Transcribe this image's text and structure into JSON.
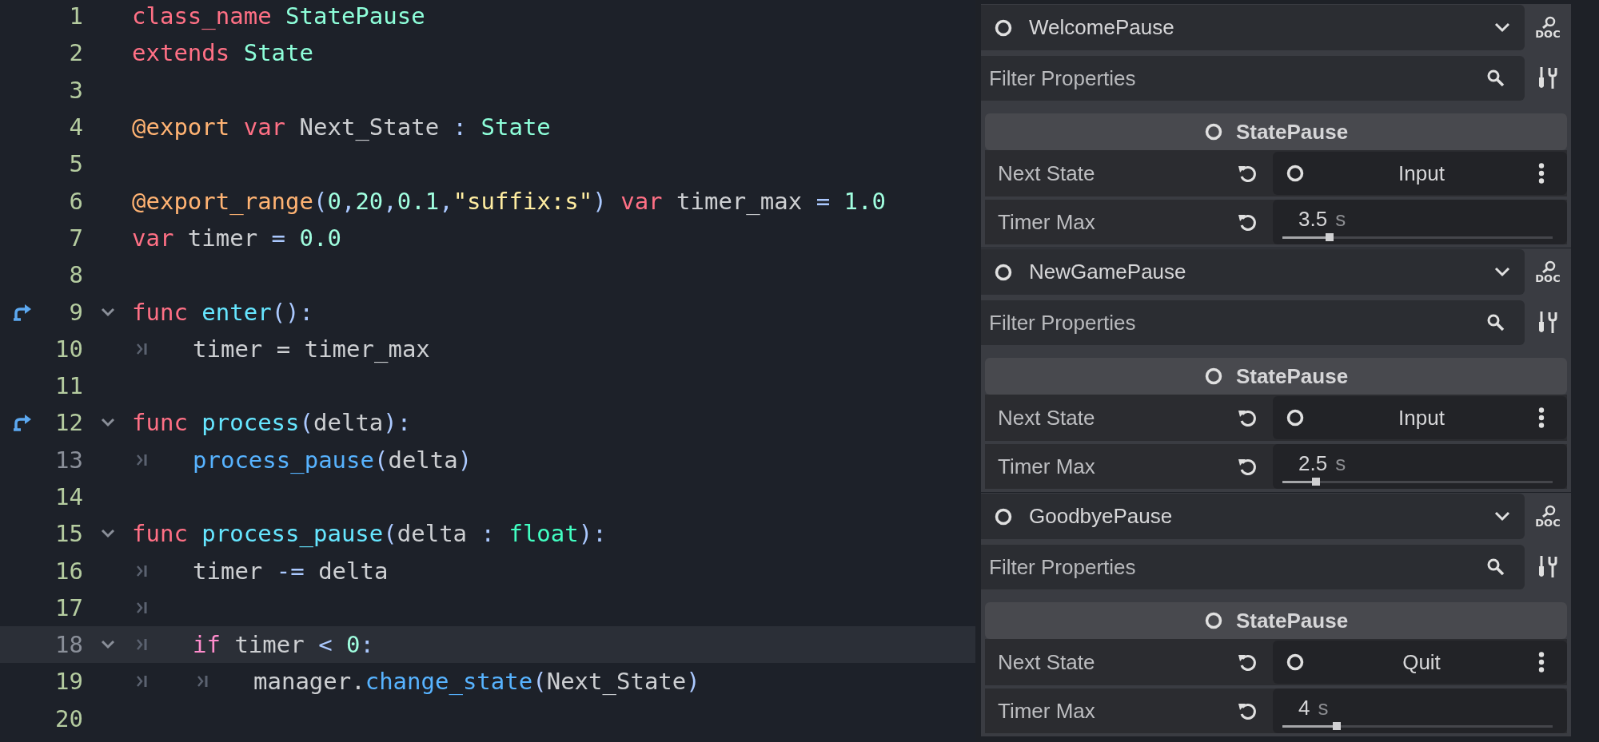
{
  "code_editor": {
    "lines": [
      {
        "number": "1",
        "safe": true,
        "tokens": [
          {
            "kind": "keyword",
            "text": "class_name "
          },
          {
            "kind": "type",
            "text": "StatePause"
          }
        ]
      },
      {
        "number": "2",
        "safe": true,
        "tokens": [
          {
            "kind": "keyword",
            "text": "extends "
          },
          {
            "kind": "type",
            "text": "State"
          }
        ]
      },
      {
        "number": "3",
        "safe": true
      },
      {
        "number": "4",
        "safe": true,
        "tokens": [
          {
            "kind": "annotation",
            "text": "@export "
          },
          {
            "kind": "keyword",
            "text": "var"
          },
          {
            "kind": "plain",
            "text": " Next_State "
          },
          {
            "kind": "symbol",
            "text": ": "
          },
          {
            "kind": "type",
            "text": "State"
          }
        ]
      },
      {
        "number": "5",
        "safe": true
      },
      {
        "number": "6",
        "safe": true,
        "tokens": [
          {
            "kind": "annotation",
            "text": "@export_range"
          },
          {
            "kind": "symbol",
            "text": "("
          },
          {
            "kind": "number",
            "text": "0"
          },
          {
            "kind": "symbol",
            "text": ","
          },
          {
            "kind": "number",
            "text": "20"
          },
          {
            "kind": "symbol",
            "text": ","
          },
          {
            "kind": "number",
            "text": "0.1"
          },
          {
            "kind": "symbol",
            "text": ","
          },
          {
            "kind": "string",
            "text": "\"suffix:s\""
          },
          {
            "kind": "symbol",
            "text": ") "
          },
          {
            "kind": "keyword",
            "text": "var"
          },
          {
            "kind": "plain",
            "text": " timer_max "
          },
          {
            "kind": "symbol",
            "text": "= "
          },
          {
            "kind": "number",
            "text": "1.0"
          }
        ]
      },
      {
        "number": "7",
        "safe": true,
        "tokens": [
          {
            "kind": "keyword",
            "text": "var"
          },
          {
            "kind": "plain",
            "text": " timer "
          },
          {
            "kind": "symbol",
            "text": "= "
          },
          {
            "kind": "number",
            "text": "0.0"
          }
        ]
      },
      {
        "number": "8",
        "safe": true
      },
      {
        "number": "9",
        "safe": true,
        "override": true,
        "fold": true,
        "tokens": [
          {
            "kind": "keyword",
            "text": "func "
          },
          {
            "kind": "function",
            "text": "enter"
          },
          {
            "kind": "symbol",
            "text": "():"
          }
        ]
      },
      {
        "number": "10",
        "safe": true,
        "tokens": [
          {
            "kind": "tab"
          },
          {
            "kind": "plain",
            "text": "timer = timer_max"
          }
        ]
      },
      {
        "number": "11",
        "safe": true
      },
      {
        "number": "12",
        "safe": true,
        "override": true,
        "fold": true,
        "tokens": [
          {
            "kind": "keyword",
            "text": "func "
          },
          {
            "kind": "function",
            "text": "process"
          },
          {
            "kind": "symbol",
            "text": "("
          },
          {
            "kind": "plain",
            "text": "delta"
          },
          {
            "kind": "symbol",
            "text": "):"
          }
        ]
      },
      {
        "number": "13",
        "safe": false,
        "tokens": [
          {
            "kind": "tab"
          },
          {
            "kind": "call",
            "text": "process_pause"
          },
          {
            "kind": "symbol",
            "text": "("
          },
          {
            "kind": "plain",
            "text": "delta"
          },
          {
            "kind": "symbol",
            "text": ")"
          }
        ]
      },
      {
        "number": "14",
        "safe": true
      },
      {
        "number": "15",
        "safe": true,
        "fold": true,
        "tokens": [
          {
            "kind": "keyword",
            "text": "func "
          },
          {
            "kind": "function",
            "text": "process_pause"
          },
          {
            "kind": "symbol",
            "text": "("
          },
          {
            "kind": "plain",
            "text": "delta "
          },
          {
            "kind": "symbol",
            "text": ": "
          },
          {
            "kind": "builtin",
            "text": "float"
          },
          {
            "kind": "symbol",
            "text": "):"
          }
        ]
      },
      {
        "number": "16",
        "safe": true,
        "tokens": [
          {
            "kind": "tab"
          },
          {
            "kind": "plain",
            "text": "timer "
          },
          {
            "kind": "symbol",
            "text": "-="
          },
          {
            "kind": "plain",
            "text": " delta"
          }
        ]
      },
      {
        "number": "17",
        "safe": true,
        "tokens": [
          {
            "kind": "tab"
          }
        ]
      },
      {
        "number": "18",
        "safe": false,
        "fold": true,
        "current": true,
        "tokens": [
          {
            "kind": "tab"
          },
          {
            "kind": "control",
            "text": "if"
          },
          {
            "kind": "plain",
            "text": " timer "
          },
          {
            "kind": "symbol",
            "text": "< "
          },
          {
            "kind": "number",
            "text": "0"
          },
          {
            "kind": "symbol",
            "text": ":"
          }
        ]
      },
      {
        "number": "19",
        "safe": true,
        "tokens": [
          {
            "kind": "tab"
          },
          {
            "kind": "tab"
          },
          {
            "kind": "plain",
            "text": "manager."
          },
          {
            "kind": "call",
            "text": "change_state"
          },
          {
            "kind": "symbol",
            "text": "("
          },
          {
            "kind": "plain",
            "text": "Next_State"
          },
          {
            "kind": "symbol",
            "text": ")"
          }
        ]
      },
      {
        "number": "20",
        "safe": true
      }
    ]
  },
  "inspectors": [
    {
      "node_name": "WelcomePause",
      "doc_label": "DOC",
      "filter": {
        "placeholder": "Filter Properties"
      },
      "section": "StatePause",
      "properties": [
        {
          "kind": "node",
          "label": "Next State",
          "value": "Input"
        },
        {
          "kind": "slider",
          "label": "Timer Max",
          "value": "3.5",
          "suffix": "s",
          "level": 0.175
        }
      ]
    },
    {
      "node_name": "NewGamePause",
      "doc_label": "DOC",
      "filter": {
        "placeholder": "Filter Properties"
      },
      "section": "StatePause",
      "properties": [
        {
          "kind": "node",
          "label": "Next State",
          "value": "Input"
        },
        {
          "kind": "slider",
          "label": "Timer Max",
          "value": "2.5",
          "suffix": "s",
          "level": 0.125
        }
      ]
    },
    {
      "node_name": "GoodbyePause",
      "doc_label": "DOC",
      "filter": {
        "placeholder": "Filter Properties"
      },
      "section": "StatePause",
      "properties": [
        {
          "kind": "node",
          "label": "Next State",
          "value": "Quit"
        },
        {
          "kind": "slider",
          "label": "Timer Max",
          "value": "4",
          "suffix": "s",
          "level": 0.2
        }
      ]
    }
  ]
}
